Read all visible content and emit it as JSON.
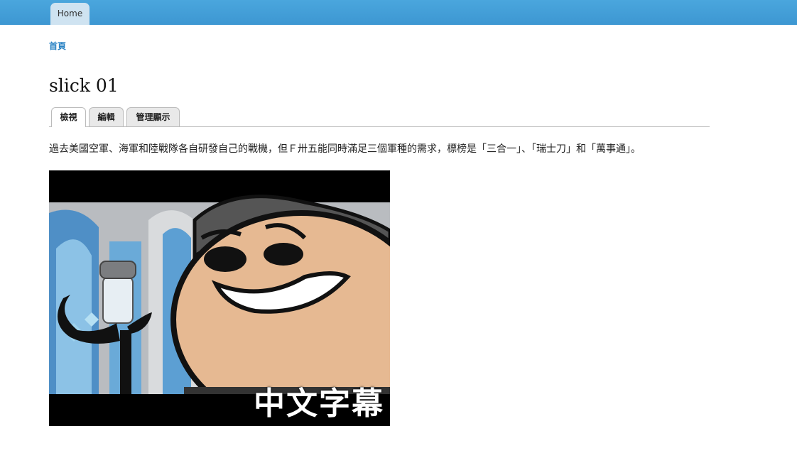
{
  "topbar": {
    "home_label": "Home"
  },
  "breadcrumb": {
    "home": "首頁"
  },
  "page": {
    "title": "slick 01",
    "tabs": [
      {
        "label": "檢視",
        "active": true
      },
      {
        "label": "編輯",
        "active": false
      },
      {
        "label": "管理顯示",
        "active": false
      }
    ],
    "body_text": "過去美國空軍、海軍和陸戰隊各自研發自己的戰機，但Ｆ卅五能同時滿足三個軍種的需求，標榜是「三合一」、「瑞士刀」和「萬事通」。"
  },
  "image": {
    "caption_overlay": "中文字幕"
  },
  "colors": {
    "topbar": "#3d97d2",
    "link": "#2a83c4"
  }
}
